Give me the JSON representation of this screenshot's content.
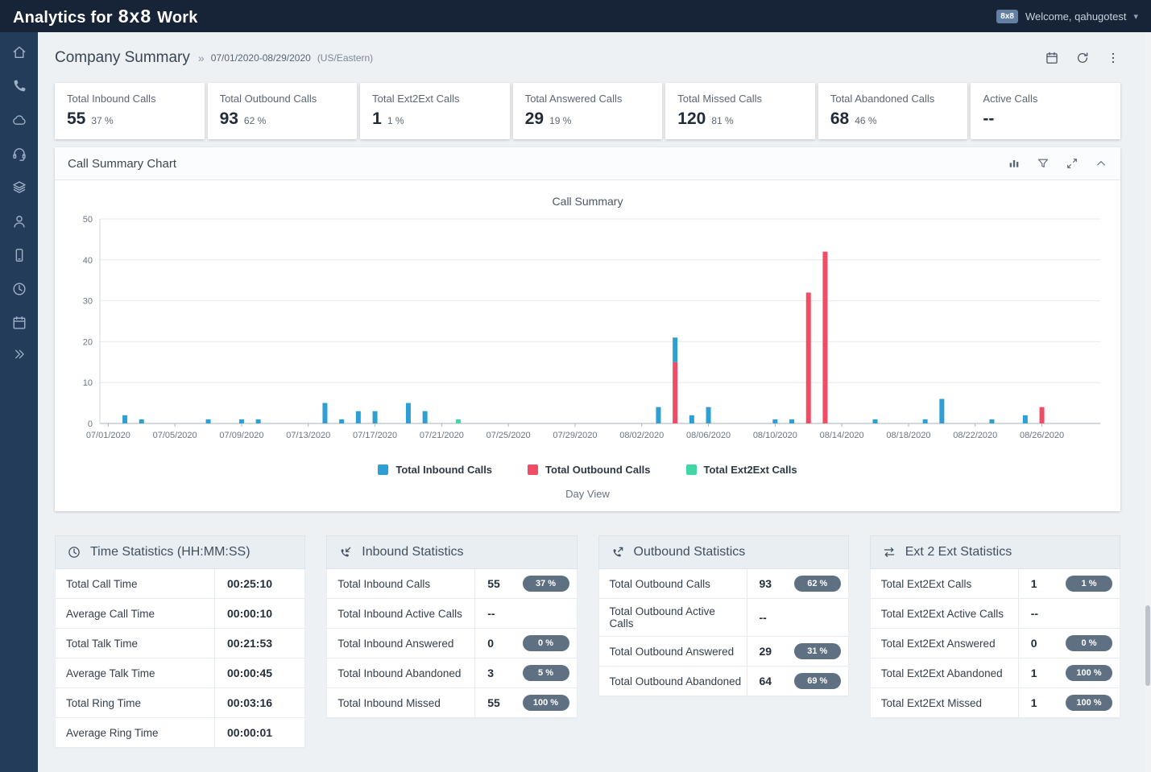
{
  "topbar": {
    "brand_prefix": "Analytics for",
    "brand_logo": "8x8",
    "brand_suffix": "Work",
    "user_badge": "8x8",
    "welcome_text": "Welcome, qahugotest"
  },
  "sidebar": {
    "items": [
      {
        "name": "home",
        "icon": "home-icon"
      },
      {
        "name": "calls",
        "icon": "phone-icon"
      },
      {
        "name": "cloud-services",
        "icon": "cloud-icon"
      },
      {
        "name": "agents",
        "icon": "headset-icon"
      },
      {
        "name": "queues",
        "icon": "queues-icon"
      },
      {
        "name": "users",
        "icon": "user-icon"
      },
      {
        "name": "devices",
        "icon": "device-icon"
      },
      {
        "name": "time",
        "icon": "clock-icon"
      },
      {
        "name": "schedule",
        "icon": "calendar-icon"
      }
    ],
    "expand_icon": "double-chevron-right-icon"
  },
  "page_header": {
    "title": "Company Summary",
    "separator": "»",
    "date_range": "07/01/2020-08/29/2020",
    "timezone": "(US/Eastern)"
  },
  "summary_cards": [
    {
      "label": "Total Inbound Calls",
      "value": "55",
      "percent": "37 %"
    },
    {
      "label": "Total Outbound Calls",
      "value": "93",
      "percent": "62 %"
    },
    {
      "label": "Total Ext2Ext Calls",
      "value": "1",
      "percent": "1 %"
    },
    {
      "label": "Total Answered Calls",
      "value": "29",
      "percent": "19 %"
    },
    {
      "label": "Total Missed Calls",
      "value": "120",
      "percent": "81 %"
    },
    {
      "label": "Total Abandoned Calls",
      "value": "68",
      "percent": "46 %"
    },
    {
      "label": "Active Calls",
      "value": "--",
      "percent": ""
    }
  ],
  "chart_panel": {
    "title": "Call Summary Chart",
    "footer": "Day View"
  },
  "chart_data": {
    "type": "bar",
    "stacked": true,
    "title": "Call Summary",
    "ylim": [
      0,
      50
    ],
    "yticks": [
      0,
      10,
      20,
      30,
      40,
      50
    ],
    "x_start_date": "07/01/2020",
    "x_end_date": "08/29/2020",
    "total_days": 60,
    "tick_interval_days": 4,
    "xticks": [
      "07/01/2020",
      "07/05/2020",
      "07/09/2020",
      "07/13/2020",
      "07/17/2020",
      "07/21/2020",
      "07/25/2020",
      "07/29/2020",
      "08/02/2020",
      "08/06/2020",
      "08/10/2020",
      "08/14/2020",
      "08/18/2020",
      "08/22/2020",
      "08/26/2020"
    ],
    "grid": true,
    "legend_position": "bottom",
    "stack_order": [
      "Total Outbound Calls",
      "Total Inbound Calls",
      "Total Ext2Ext Calls"
    ],
    "series": [
      {
        "name": "Total Inbound Calls",
        "color": "#2e9fd4",
        "total": 55,
        "points": [
          [
            "07/02/2020",
            2
          ],
          [
            "07/03/2020",
            1
          ],
          [
            "07/07/2020",
            1
          ],
          [
            "07/09/2020",
            1
          ],
          [
            "07/10/2020",
            1
          ],
          [
            "07/14/2020",
            5
          ],
          [
            "07/15/2020",
            1
          ],
          [
            "07/16/2020",
            3
          ],
          [
            "07/17/2020",
            3
          ],
          [
            "07/19/2020",
            5
          ],
          [
            "07/20/2020",
            3
          ],
          [
            "08/03/2020",
            4
          ],
          [
            "08/04/2020",
            6
          ],
          [
            "08/05/2020",
            2
          ],
          [
            "08/06/2020",
            4
          ],
          [
            "08/10/2020",
            1
          ],
          [
            "08/11/2020",
            1
          ],
          [
            "08/16/2020",
            1
          ],
          [
            "08/19/2020",
            1
          ],
          [
            "08/20/2020",
            6
          ],
          [
            "08/23/2020",
            1
          ],
          [
            "08/25/2020",
            2
          ]
        ]
      },
      {
        "name": "Total Outbound Calls",
        "color": "#ee4d63",
        "total": 93,
        "points": [
          [
            "08/04/2020",
            15
          ],
          [
            "08/12/2020",
            32
          ],
          [
            "08/13/2020",
            42
          ],
          [
            "08/26/2020",
            4
          ]
        ]
      },
      {
        "name": "Total Ext2Ext Calls",
        "color": "#43d6a4",
        "total": 1,
        "points": [
          [
            "07/22/2020",
            1
          ]
        ]
      }
    ]
  },
  "stat_panels": [
    {
      "id": "time",
      "icon": "clock-icon",
      "title": "Time Statistics (HH:MM:SS)",
      "rows": [
        {
          "label": "Total Call Time",
          "value": "00:25:10"
        },
        {
          "label": "Average Call Time",
          "value": "00:00:10"
        },
        {
          "label": "Total Talk Time",
          "value": "00:21:53"
        },
        {
          "label": "Average Talk Time",
          "value": "00:00:45"
        },
        {
          "label": "Total Ring Time",
          "value": "00:03:16"
        },
        {
          "label": "Average Ring Time",
          "value": "00:00:01"
        }
      ]
    },
    {
      "id": "inbound",
      "icon": "inbound-call-icon",
      "title": "Inbound Statistics",
      "rows": [
        {
          "label": "Total Inbound Calls",
          "value": "55",
          "badge": "37 %"
        },
        {
          "label": "Total Inbound Active Calls",
          "value": "--"
        },
        {
          "label": "Total Inbound Answered",
          "value": "0",
          "badge": "0 %"
        },
        {
          "label": "Total Inbound Abandoned",
          "value": "3",
          "badge": "5 %"
        },
        {
          "label": "Total Inbound Missed",
          "value": "55",
          "badge": "100 %"
        }
      ]
    },
    {
      "id": "outbound",
      "icon": "outbound-call-icon",
      "title": "Outbound Statistics",
      "rows": [
        {
          "label": "Total Outbound Calls",
          "value": "93",
          "badge": "62 %"
        },
        {
          "label": "Total Outbound Active Calls",
          "value": "--"
        },
        {
          "label": "Total Outbound Answered",
          "value": "29",
          "badge": "31 %"
        },
        {
          "label": "Total Outbound Abandoned",
          "value": "64",
          "badge": "69 %"
        }
      ]
    },
    {
      "id": "ext2ext",
      "icon": "ext2ext-icon",
      "title": "Ext 2 Ext Statistics",
      "rows": [
        {
          "label": "Total Ext2Ext Calls",
          "value": "1",
          "badge": "1 %"
        },
        {
          "label": "Total Ext2Ext Active Calls",
          "value": "--"
        },
        {
          "label": "Total Ext2Ext Answered",
          "value": "0",
          "badge": "0 %"
        },
        {
          "label": "Total Ext2Ext Abandoned",
          "value": "1",
          "badge": "100 %"
        },
        {
          "label": "Total Ext2Ext Missed",
          "value": "1",
          "badge": "100 %"
        }
      ]
    }
  ],
  "colors": {
    "inbound": "#2e9fd4",
    "outbound": "#ee4d63",
    "ext2ext": "#43d6a4",
    "badge_bg": "#5e7082",
    "topbar_bg": "#172337",
    "sidebar_bg": "#223c59"
  }
}
